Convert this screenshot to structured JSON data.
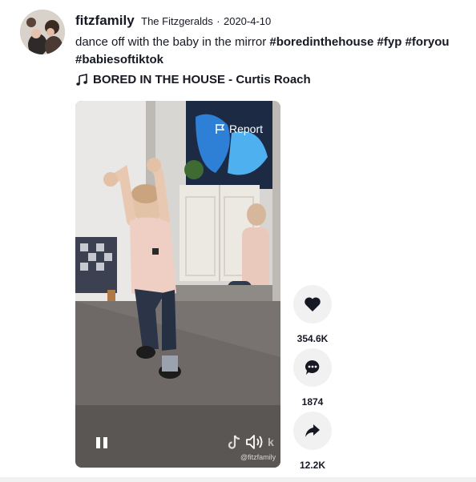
{
  "post": {
    "username": "fitzfamily",
    "nickname": "The Fitzgeralds",
    "separator": "·",
    "date": "2020-4-10",
    "caption_text": "dance off with the baby in the mirror",
    "hashtags": [
      "#boredinthehouse",
      "#fyp",
      "#foryou",
      "#babiesoftiktok"
    ],
    "music": "BORED IN THE HOUSE - Curtis Roach"
  },
  "video": {
    "report_label": "Report",
    "watermark": "@fitzfamily",
    "watermark_logo_text": "k",
    "state": "playing"
  },
  "actions": {
    "like_count": "354.6K",
    "comment_count": "1874",
    "share_count": "12.2K"
  },
  "icons": {
    "avatar": "avatar-photo",
    "music": "music-note-icon",
    "report": "flag-icon",
    "pause": "pause-icon",
    "volume": "volume-icon",
    "like": "heart-icon",
    "comment": "comment-icon",
    "share": "share-arrow-icon",
    "brand": "tiktok-logo-icon"
  },
  "colors": {
    "text": "#161823",
    "action_circle": "#f1f1f2",
    "video_overlay_text": "#ffffff"
  }
}
